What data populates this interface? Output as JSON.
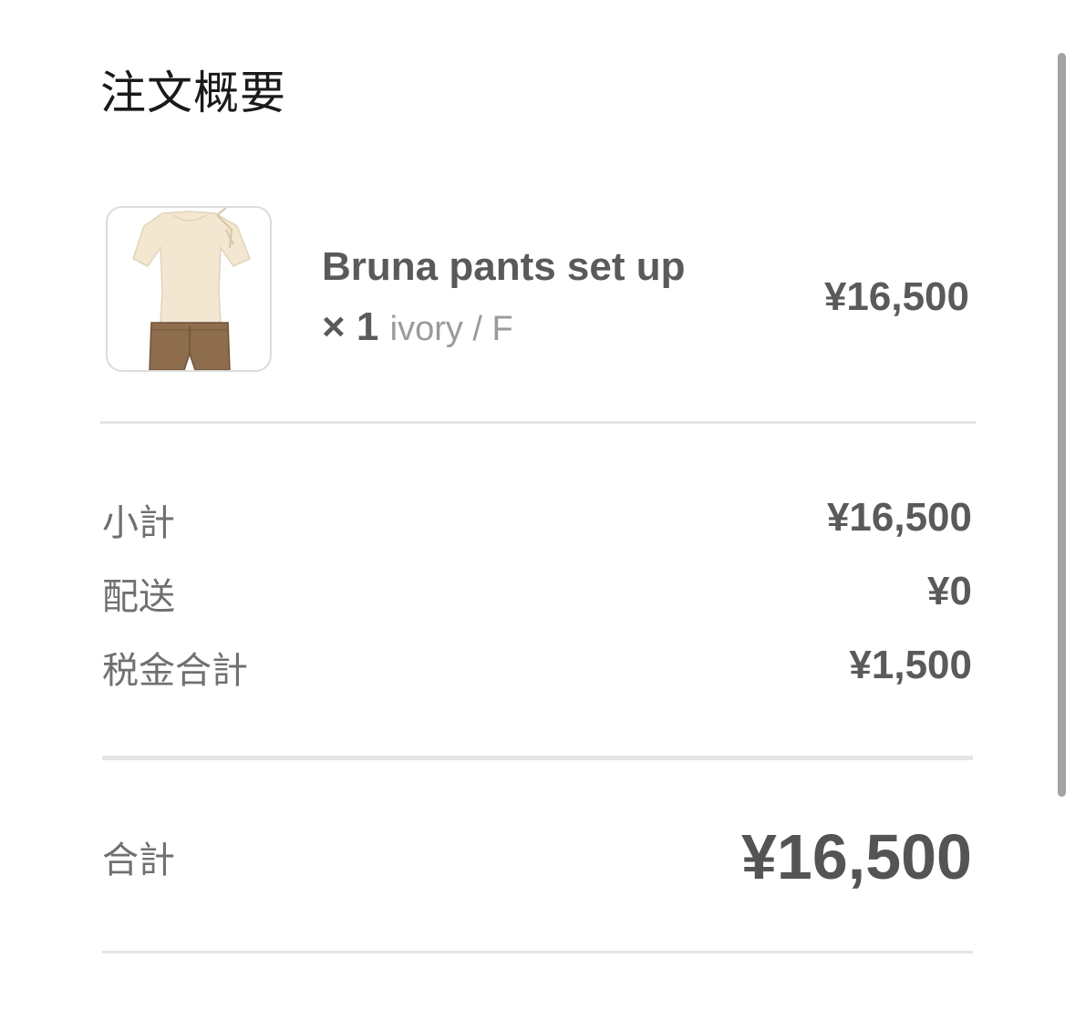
{
  "header": {
    "title": "注文概要"
  },
  "line_item": {
    "name": "Bruna pants set up × 1",
    "variant": "ivory / F",
    "price": "¥16,500",
    "thumbnail_icon": "product-image-top-and-shorts"
  },
  "summary": {
    "subtotal_label": "小計",
    "subtotal_value": "¥16,500",
    "shipping_label": "配送",
    "shipping_value": "¥0",
    "tax_label": "税金合計",
    "tax_value": "¥1,500"
  },
  "total": {
    "label": "合計",
    "value": "¥16,500"
  },
  "colors": {
    "text_dark": "#1a1a1a",
    "text_value": "#5a5a5a",
    "text_muted": "#707070",
    "variant": "#9a9a9a",
    "divider": "#e5e5e5",
    "top_color": "#f3e7d2",
    "shorts_color": "#8d6d4c"
  }
}
